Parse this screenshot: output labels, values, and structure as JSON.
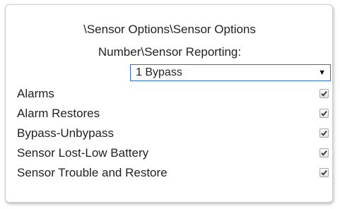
{
  "header": {
    "title_line1": "\\Sensor Options\\Sensor Options",
    "title_line2": "Number\\Sensor Reporting:"
  },
  "select": {
    "value": "1 Bypass",
    "arrow": "▼"
  },
  "options": [
    {
      "label": "Alarms",
      "checked": true
    },
    {
      "label": "Alarm Restores",
      "checked": true
    },
    {
      "label": "Bypass-Unbypass",
      "checked": true
    },
    {
      "label": "Sensor Lost-Low Battery",
      "checked": true
    },
    {
      "label": "Sensor Trouble and Restore",
      "checked": true
    }
  ],
  "colors": {
    "select_border": "#2f6fc9",
    "panel_border": "#cfcfcf",
    "text": "#222222"
  }
}
